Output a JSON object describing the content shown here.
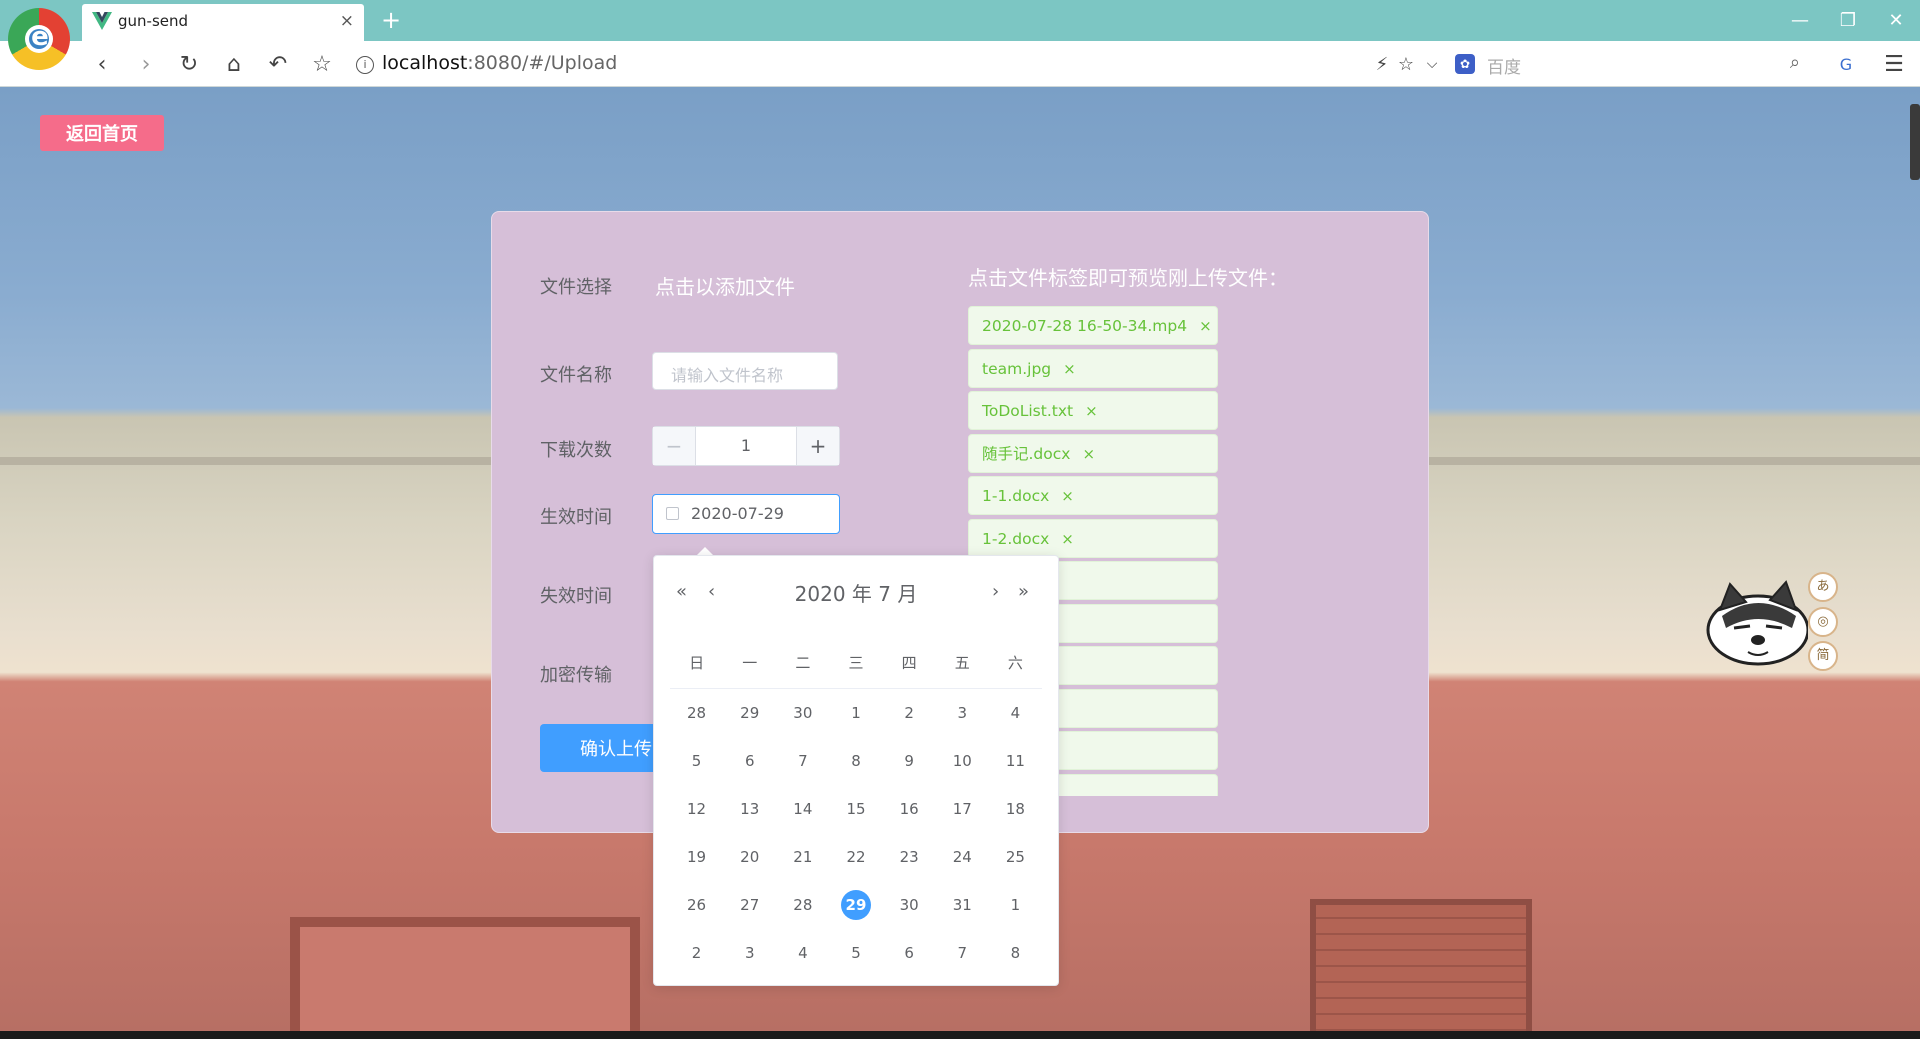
{
  "browser": {
    "tab_title": "gun-send",
    "tab_close": "×",
    "new_tab": "+",
    "url_host": "localhost",
    "url_path": ":8080/#/Upload",
    "search_placeholder": "百度",
    "window_controls": [
      "—",
      "❐",
      "✕"
    ]
  },
  "app": {
    "back_label": "返回首页",
    "form": {
      "file_select_label": "文件选择",
      "file_select_link": "点击以添加文件",
      "file_name_label": "文件名称",
      "file_name_placeholder": "请输入文件名称",
      "download_count_label": "下载次数",
      "download_count_value": "1",
      "decrement": "−",
      "increment": "+",
      "start_time_label": "生效时间",
      "start_time_value": "2020-07-29",
      "end_time_label": "失效时间",
      "encrypt_label": "加密传输",
      "submit_label": "确认上传"
    },
    "uploaded": {
      "title": "点击文件标签即可预览刚上传文件：",
      "files": [
        "2020-07-28 16-50-34.mp4",
        "team.jpg",
        "ToDoList.txt",
        "随手记.docx",
        "1-1.docx",
        "1-2.docx",
        "",
        "",
        "",
        "",
        "",
        ""
      ],
      "close_symbol": "×"
    },
    "date_picker": {
      "prev_year": "«",
      "prev_month": "‹",
      "next_month": "›",
      "next_year": "»",
      "title": "2020 年  7 月",
      "weekdays": [
        "日",
        "一",
        "二",
        "三",
        "四",
        "五",
        "六"
      ],
      "weeks": [
        [
          "28",
          "29",
          "30",
          "1",
          "2",
          "3",
          "4"
        ],
        [
          "5",
          "6",
          "7",
          "8",
          "9",
          "10",
          "11"
        ],
        [
          "12",
          "13",
          "14",
          "15",
          "16",
          "17",
          "18"
        ],
        [
          "19",
          "20",
          "21",
          "22",
          "23",
          "24",
          "25"
        ],
        [
          "26",
          "27",
          "28",
          "29",
          "30",
          "31",
          "1"
        ],
        [
          "2",
          "3",
          "4",
          "5",
          "6",
          "7",
          "8"
        ]
      ],
      "selected": "29"
    },
    "side_widget": {
      "bubbles": [
        "あ",
        "◎",
        "简"
      ]
    }
  },
  "colors": {
    "primary": "#409eff",
    "danger_pink": "#f56c8a",
    "panel": "#d6bfd8",
    "tag_text": "#67c23a",
    "chrome_teal": "#7cc6c3"
  }
}
